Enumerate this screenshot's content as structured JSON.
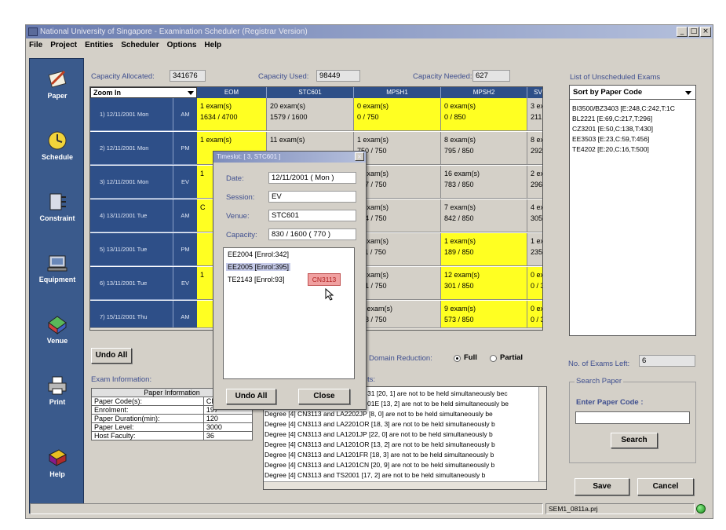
{
  "window": {
    "title": "National University of Singapore - Examination Scheduler (Registrar Version)",
    "controls": [
      "_",
      "□",
      "×"
    ]
  },
  "menu": [
    "File",
    "Project",
    "Entities",
    "Scheduler",
    "Options",
    "Help"
  ],
  "sidebar": [
    {
      "label": "Paper",
      "icon": "paper-icon"
    },
    {
      "label": "Schedule",
      "icon": "clock-icon"
    },
    {
      "label": "Constraint",
      "icon": "constraint-icon"
    },
    {
      "label": "Equipment",
      "icon": "equipment-icon"
    },
    {
      "label": "Venue",
      "icon": "venue-icon"
    },
    {
      "label": "Print",
      "icon": "printer-icon"
    },
    {
      "label": "Help",
      "icon": "book-icon"
    }
  ],
  "capacity": {
    "allocated_label": "Capacity Allocated:",
    "allocated": "341676",
    "used_label": "Capacity Used:",
    "used": "98449",
    "needed_label": "Capacity Needed:",
    "needed": "627"
  },
  "grid": {
    "zoom_label": "Zoom In",
    "columns": [
      "EOM",
      "STC601",
      "MPSH1",
      "MPSH2",
      "SV"
    ],
    "rows": [
      {
        "date": "1) 12/11/2001 Mon",
        "session": "AM",
        "cells": [
          [
            "1 exam(s)",
            "1634 / 4700",
            "y"
          ],
          [
            "20 exam(s)",
            "1579 / 1600",
            "g"
          ],
          [
            "0 exam(s)",
            "0 / 750",
            "y"
          ],
          [
            "0 exam(s)",
            "0 / 850",
            "y"
          ],
          [
            "3 ex",
            "211",
            "g"
          ]
        ]
      },
      {
        "date": "2) 12/11/2001 Mon",
        "session": "PM",
        "cells": [
          [
            "1 exam(s)",
            "",
            "y"
          ],
          [
            "11 exam(s)",
            "",
            "g"
          ],
          [
            "1 exam(s)",
            "750 / 750",
            "g"
          ],
          [
            "8 exam(s)",
            "795 / 850",
            "g"
          ],
          [
            "8 ex",
            "292",
            "g"
          ]
        ]
      },
      {
        "date": "3) 12/11/2001 Mon",
        "session": "EV",
        "cells": [
          [
            "1",
            "",
            "y"
          ],
          [
            "",
            "",
            "g"
          ],
          [
            "8 exam(s)",
            "637 / 750",
            "g"
          ],
          [
            "16 exam(s)",
            "783 / 850",
            "g"
          ],
          [
            "2 ex",
            "296",
            "g"
          ]
        ]
      },
      {
        "date": "4) 13/11/2001 Tue",
        "session": "AM",
        "cells": [
          [
            "C",
            "",
            "y"
          ],
          [
            "",
            "",
            "g"
          ],
          [
            "1 exam(s)",
            "674 / 750",
            "g"
          ],
          [
            "7 exam(s)",
            "842 / 850",
            "g"
          ],
          [
            "4 ex",
            "305",
            "g"
          ]
        ]
      },
      {
        "date": "5) 13/11/2001 Tue",
        "session": "PM",
        "cells": [
          [
            "",
            "",
            "y"
          ],
          [
            "",
            "",
            "g"
          ],
          [
            "2 exam(s)",
            "711 / 750",
            "g"
          ],
          [
            "1 exam(s)",
            "189 / 850",
            "y"
          ],
          [
            "1 ex",
            "235",
            "g"
          ]
        ]
      },
      {
        "date": "6) 13/11/2001 Tue",
        "session": "EV",
        "cells": [
          [
            "1",
            "",
            "y"
          ],
          [
            "",
            "",
            "g"
          ],
          [
            "3 exam(s)",
            "661 / 750",
            "g"
          ],
          [
            "12 exam(s)",
            "301 / 850",
            "y"
          ],
          [
            "0 ex",
            "0 / 3",
            "y"
          ]
        ]
      },
      {
        "date": "7) 15/11/2001 Thu",
        "session": "AM",
        "cells": [
          [
            "",
            "",
            "y"
          ],
          [
            "",
            "",
            "g"
          ],
          [
            "12 exam(s)",
            "718 / 750",
            "g"
          ],
          [
            "9 exam(s)",
            "573 / 850",
            "y"
          ],
          [
            "0 ex",
            "0 / 3",
            "y"
          ]
        ]
      }
    ]
  },
  "unscheduled": {
    "title": "List of Unscheduled Exams",
    "sort_label": "Sort by Paper Code",
    "items": [
      "BI3500/BZ3403 [E:248,C:242,T:1C",
      "BL2221 [E:69,C:217,T:296]",
      "CZ3201 [E:50,C:138,T:430]",
      "EE3503 [E:23,C:59,T:456]",
      "TE4202 [E:20,C:16,T:500]"
    ],
    "left_label": "No. of Exams Left:",
    "left_value": "6"
  },
  "dialog": {
    "title": "Timeslot: [ 3, STC601 ]",
    "date_label": "Date:",
    "date": "12/11/2001 ( Mon )",
    "session_label": "Session:",
    "session": "EV",
    "venue_label": "Venue:",
    "venue": "STC601",
    "capacity_label": "Capacity:",
    "capacity": "830 / 1600 ( 770 )",
    "exams": [
      "EE2004 [Enrol:342]",
      "EE2005 [Enrol:395]",
      "TE2143 [Enrol:93]"
    ],
    "drag_tag": "CN3113",
    "undo_label": "Undo All",
    "close_label": "Close"
  },
  "undo_all_label": "Undo All",
  "domain": {
    "label": "Domain Reduction:",
    "full": "Full",
    "partial": "Partial"
  },
  "exam_info": {
    "title": "Exam Information:",
    "header": "Paper Information",
    "rows": [
      [
        "Paper Code(s):",
        "CN3113"
      ],
      [
        "Enrolment:",
        "197"
      ],
      [
        "Paper Duration(min):",
        "120"
      ],
      [
        "Paper Level:",
        "3000"
      ],
      [
        "Host Faculty:",
        "36"
      ]
    ]
  },
  "conflicts": {
    "label": "ts:",
    "lines": [
      "31 [20, 1] are not to be held simultaneously bec",
      "01E [13, 2] are not to be held simultaneously be",
      "Degree [4] CN3113 and LA2202JP [8, 0] are not to be held simultaneously be",
      "Degree [4] CN3113 and LA2201OR [18, 3] are not to be held simultaneously b",
      "Degree [4] CN3113 and LA1201JP [22, 0] are not to be held simultaneously b",
      "Degree [4] CN3113 and LA1201OR [13, 2] are not to be held simultaneously b",
      "Degree [4] CN3113 and LA1201FR [18, 3] are not to be held simultaneously b",
      "Degree [4] CN3113 and LA1201CN [20, 9] are not to be held simultaneously b",
      "Degree [4] CN3113 and TS2001 [17, 2] are not to be held simultaneously b"
    ]
  },
  "search": {
    "title": "Search Paper",
    "enter_label": "Enter Paper Code :",
    "input_value": "",
    "button": "Search"
  },
  "buttons": {
    "save": "Save",
    "cancel": "Cancel"
  },
  "status": {
    "file": "SEM1_0811a.prj"
  }
}
